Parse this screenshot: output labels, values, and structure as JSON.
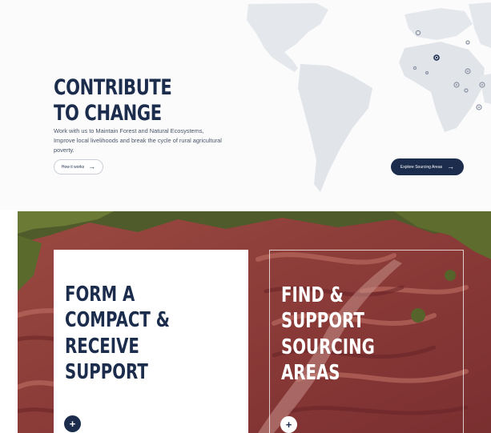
{
  "hero": {
    "title": "CONTRIBUTE TO CHANGE",
    "body": "Work with us to Maintain Forest and Natural Ecosystems, Improve local livelihoods and break the cycle of rural agricultural poverty.",
    "how_button_label": "How it works",
    "explore_button_label": "Explore Sourcing Areas",
    "arrow_icon": "arrow-right-icon"
  },
  "cards": [
    {
      "title": "FORM A COMPACT & RECEIVE SUPPORT",
      "button_icon": "plus-icon"
    },
    {
      "title": "FIND & SUPPORT SOURCING AREAS",
      "button_icon": "plus-icon"
    }
  ],
  "colors": {
    "navy": "#1b2c4c",
    "map_land": "#e3e6ea",
    "map_marker": "#8a93a3",
    "photo_earth": "#8a3e3a"
  }
}
